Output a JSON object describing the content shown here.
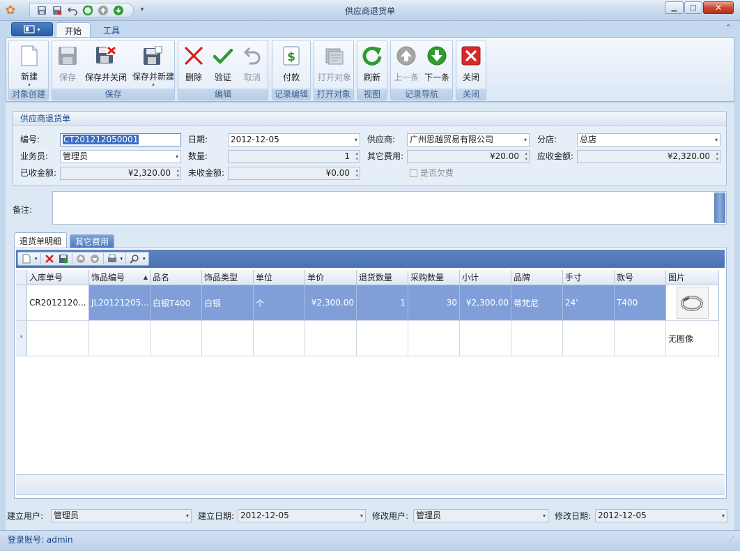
{
  "window": {
    "title": "供应商退货单"
  },
  "ribbon": {
    "tabs": [
      {
        "label": "开始",
        "active": true
      },
      {
        "label": "工具",
        "active": false
      }
    ],
    "groups": [
      {
        "caption": "对象创建",
        "buttons": [
          {
            "label": "新建",
            "icon": "new-doc-icon",
            "enabled": true
          }
        ]
      },
      {
        "caption": "保存",
        "buttons": [
          {
            "label": "保存",
            "icon": "save-icon",
            "enabled": false
          },
          {
            "label": "保存并关闭",
            "icon": "save-close-icon",
            "enabled": true
          },
          {
            "label": "保存并新建",
            "icon": "save-new-icon",
            "enabled": true
          }
        ]
      },
      {
        "caption": "编辑",
        "buttons": [
          {
            "label": "删除",
            "icon": "delete-icon",
            "enabled": true
          },
          {
            "label": "验证",
            "icon": "validate-check-icon",
            "enabled": true
          },
          {
            "label": "取消",
            "icon": "undo-icon",
            "enabled": false
          }
        ]
      },
      {
        "caption": "记录编辑",
        "buttons": [
          {
            "label": "付款",
            "icon": "payment-icon",
            "enabled": true
          }
        ]
      },
      {
        "caption": "打开对象",
        "buttons": [
          {
            "label": "打开对象",
            "icon": "open-object-icon",
            "enabled": false
          }
        ]
      },
      {
        "caption": "视图",
        "buttons": [
          {
            "label": "刷新",
            "icon": "refresh-icon",
            "enabled": true
          }
        ]
      },
      {
        "caption": "记录导航",
        "buttons": [
          {
            "label": "上一条",
            "icon": "arrow-up-icon",
            "enabled": false
          },
          {
            "label": "下一条",
            "icon": "arrow-down-icon",
            "enabled": true
          }
        ]
      },
      {
        "caption": "关闭",
        "buttons": [
          {
            "label": "关闭",
            "icon": "close-red-icon",
            "enabled": true
          }
        ]
      }
    ]
  },
  "form": {
    "section_title": "供应商退货单",
    "fields": {
      "number": {
        "label": "编号:",
        "value": "CT201212050001"
      },
      "date": {
        "label": "日期:",
        "value": "2012-12-05"
      },
      "supplier": {
        "label": "供应商:",
        "value": "广州思越贸易有限公司"
      },
      "branch": {
        "label": "分店:",
        "value": "总店"
      },
      "salesman": {
        "label": "业务员:",
        "value": "管理员"
      },
      "quantity": {
        "label": "数量:",
        "value": "1"
      },
      "other_fee": {
        "label": "其它费用:",
        "value": "¥20.00"
      },
      "receivable": {
        "label": "应收金额:",
        "value": "¥2,320.00"
      },
      "received": {
        "label": "已收金额:",
        "value": "¥2,320.00"
      },
      "unreceived": {
        "label": "未收金额:",
        "value": "¥0.00"
      },
      "owed": {
        "label": "是否欠费",
        "checked": false
      }
    },
    "memo_label": "备注:"
  },
  "grid": {
    "tabs": [
      {
        "label": "退货单明细",
        "active": true
      },
      {
        "label": "其它费用",
        "active": false
      }
    ],
    "columns": [
      "入库单号",
      "饰品编号",
      "品名",
      "饰品类型",
      "单位",
      "单价",
      "退货数量",
      "采购数量",
      "小计",
      "品牌",
      "手寸",
      "款号",
      "图片"
    ],
    "sort_column": "饰品编号",
    "rows": [
      [
        "CR2012120...",
        "JL20121205...",
        "白银T400",
        "白银",
        "个",
        "¥2,300.00",
        "1",
        "30",
        "¥2,300.00",
        "蒂梵尼",
        "24'",
        "T400",
        ""
      ]
    ],
    "new_row_image_text": "无图像"
  },
  "footer": {
    "created_by": {
      "label": "建立用户:",
      "value": "管理员"
    },
    "created_date": {
      "label": "建立日期:",
      "value": "2012-12-05"
    },
    "modified_by": {
      "label": "修改用户:",
      "value": "管理员"
    },
    "modified_date": {
      "label": "修改日期:",
      "value": "2012-12-05"
    }
  },
  "status": {
    "login": "登录账号: admin"
  },
  "colors": {
    "selection": "#809fd9",
    "accent": "#15428b",
    "grid_toolbar": "#4a72b2"
  }
}
